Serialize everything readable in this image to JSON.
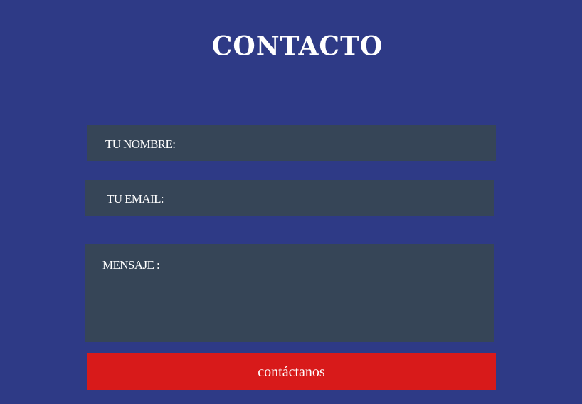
{
  "page": {
    "title": "CONTACTO"
  },
  "form": {
    "name_label": "TU NOMBRE:",
    "email_label": "TU EMAIL:",
    "message_label": "MENSAJE :",
    "submit_label": "contáctanos"
  },
  "colors": {
    "background": "#2e3a86",
    "field": "#364557",
    "button": "#d81a1a",
    "text": "#ffffff"
  }
}
